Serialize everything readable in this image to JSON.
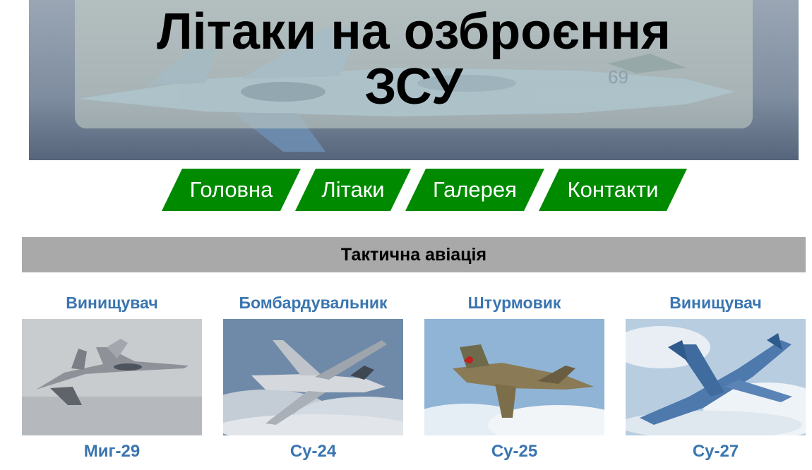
{
  "header": {
    "title": "Літаки на озброєння ЗСУ"
  },
  "nav": {
    "items": [
      {
        "label": "Головна"
      },
      {
        "label": "Літаки"
      },
      {
        "label": "Галерея"
      },
      {
        "label": "Контакти"
      }
    ]
  },
  "section": {
    "title": "Тактична авіація"
  },
  "cards": [
    {
      "role": "Винищувач",
      "model": "Миг-29",
      "image": "mig-29-photo"
    },
    {
      "role": "Бомбардувальник",
      "model": "Су-24",
      "image": "su-24-photo"
    },
    {
      "role": "Штурмовик",
      "model": "Су-25",
      "image": "su-25-photo"
    },
    {
      "role": "Винищувач",
      "model": "Су-27",
      "image": "su-27-photo"
    }
  ],
  "colors": {
    "nav_green": "#008a00",
    "section_gray": "#a9a9a9",
    "card_text_blue": "#3a75b0"
  }
}
